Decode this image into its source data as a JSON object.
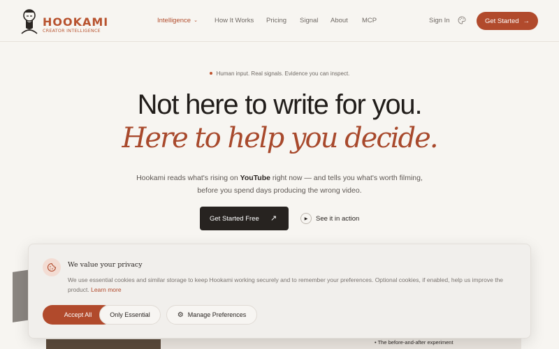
{
  "nav": {
    "logo_name": "HOOKAMI",
    "logo_tagline": "CREATOR INTELLIGENCE",
    "links": [
      {
        "label": "Intelligence",
        "active": true,
        "dropdown": true
      },
      {
        "label": "How It Works"
      },
      {
        "label": "Pricing"
      },
      {
        "label": "Signal"
      },
      {
        "label": "About"
      },
      {
        "label": "MCP"
      }
    ],
    "sign_in": "Sign In",
    "get_started": "Get Started",
    "get_started_arrow": "→"
  },
  "hero": {
    "pill": "Human input. Real signals. Evidence you can inspect.",
    "headline": "Not here to write for you.",
    "headline_italic": "Here to help you decide.",
    "sub_pre": "Hookami reads what's rising on ",
    "sub_bold": "YouTube",
    "sub_post": " right now — and tells you what's worth filming,",
    "sub_line2": "before you spend days producing the wrong video.",
    "cta_primary": "Get Started Free",
    "cta_primary_arrow": "↗",
    "cta_secondary": "See it in action"
  },
  "background": {
    "card_text": "The before-and-after experiment"
  },
  "cookie": {
    "title": "We value your privacy",
    "text": "We use essential cookies and similar storage to keep Hookami working securely and to remember your preferences. Optional cookies, if enabled, help us improve the product.",
    "learn_more": "Learn more",
    "accept": "Accept All",
    "essential": "Only Essential",
    "manage": "Manage Preferences"
  },
  "colors": {
    "accent": "#b14a2c",
    "dark": "#272320",
    "background": "#f7f5f1"
  },
  "icons": [
    "samurai-logo-icon",
    "chevron-down-icon",
    "palette-icon",
    "arrow-right-icon",
    "arrow-up-right-icon",
    "play-icon",
    "cookie-icon",
    "gear-icon"
  ]
}
